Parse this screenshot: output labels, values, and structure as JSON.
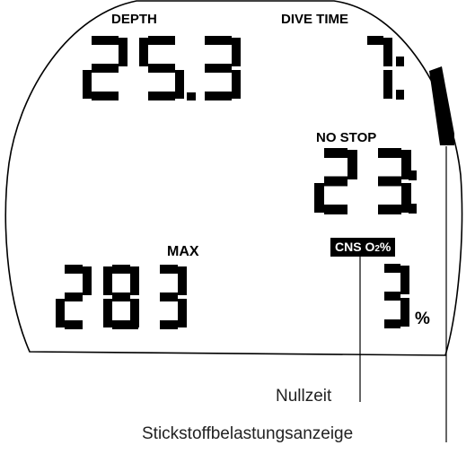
{
  "labels": {
    "depth": "DEPTH",
    "dive_time": "DIVE TIME",
    "no_stop": "NO STOP",
    "max": "MAX",
    "cns_o2": "CNS O",
    "cns_o2_sub": "2",
    "cns_o2_pct": "%",
    "percent": "%"
  },
  "readouts": {
    "depth": "25.3",
    "dive_time_minutes": "7",
    "no_stop_minutes": "23",
    "max_depth": "28.3",
    "cns_percent": "3"
  },
  "captions": {
    "no_stop_time": "Nullzeit",
    "nitrogen_loading": "Stickstoffbelastungsanzeige"
  }
}
